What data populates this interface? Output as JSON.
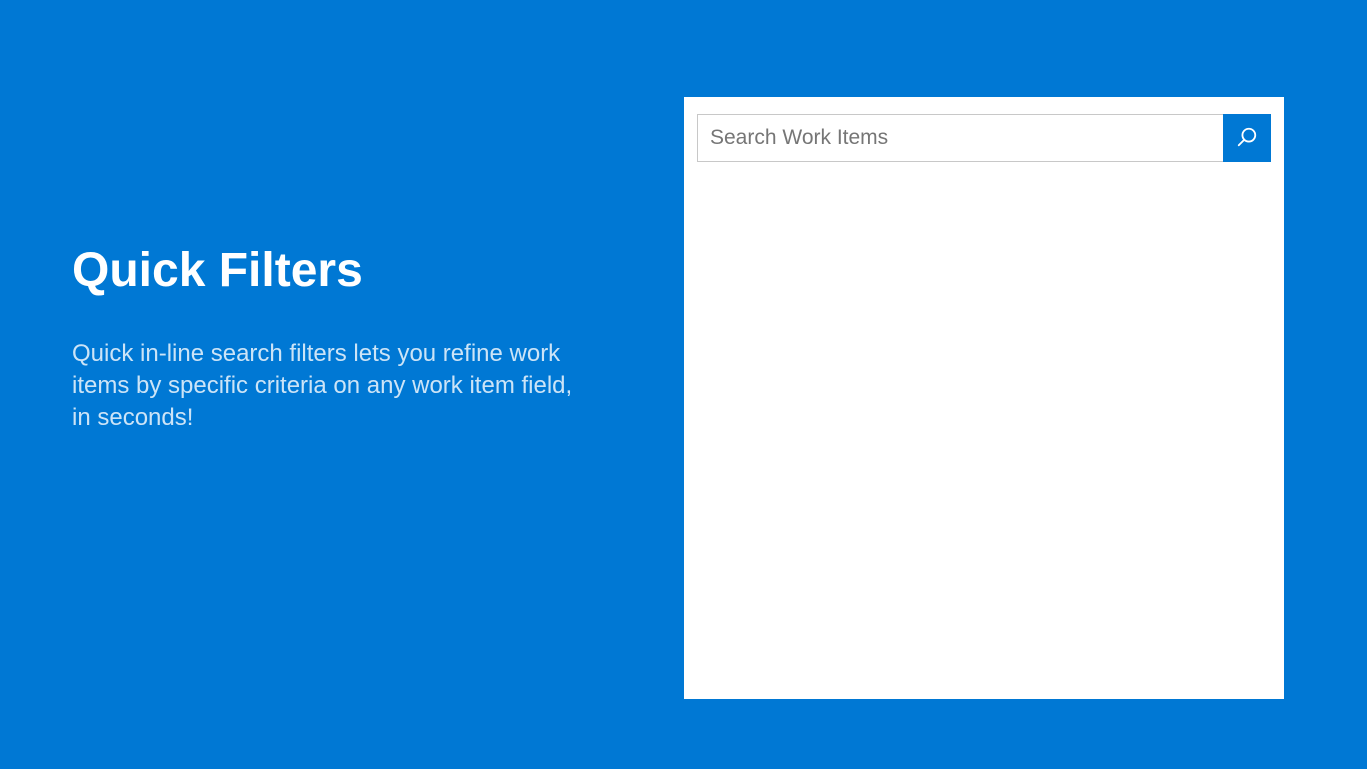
{
  "hero": {
    "title": "Quick Filters",
    "description": "Quick in-line search filters lets you refine work items by specific criteria on any work item field, in seconds!"
  },
  "search": {
    "placeholder": "Search Work Items",
    "value": ""
  },
  "colors": {
    "brand": "#0078d4",
    "panel_bg": "#ffffff"
  }
}
